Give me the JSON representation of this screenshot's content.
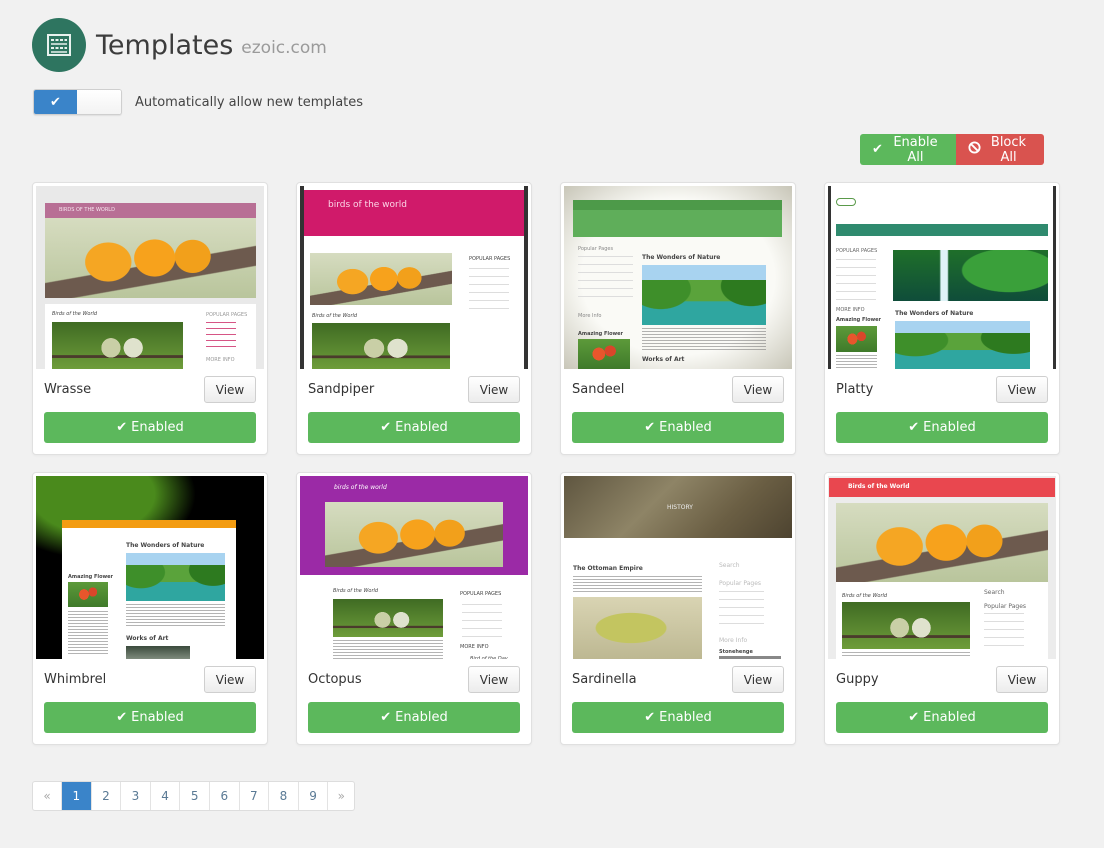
{
  "header": {
    "icon": "template-grid-icon",
    "title": "Templates",
    "site": "ezoic.com",
    "brand_color": "#2e7560"
  },
  "auto_allow": {
    "label": "Automatically allow new templates",
    "checked": true,
    "check_icon": "check-icon",
    "accent_color": "#3a84c9"
  },
  "toolbar": {
    "enable_all_label": "Enable All",
    "enable_all_icon": "check-icon",
    "block_all_label": "Block All",
    "block_all_icon": "ban-icon",
    "enable_color": "#5cb85c",
    "block_color": "#d9534f"
  },
  "templates": [
    {
      "name": "Wrasse",
      "view_label": "View",
      "status": "Enabled",
      "preview": {
        "site_title": "BIRDS OF THE WORLD",
        "heading": "Birds of the World",
        "sidebar_title": "POPULAR PAGES",
        "sidebar_more": "MORE INFO"
      }
    },
    {
      "name": "Sandpiper",
      "view_label": "View",
      "status": "Enabled",
      "preview": {
        "site_title": "birds of the world",
        "heading": "Birds of the World",
        "sidebar_title": "POPULAR PAGES"
      }
    },
    {
      "name": "Sandeel",
      "view_label": "View",
      "status": "Enabled",
      "preview": {
        "heading": "The Wonders of Nature",
        "sidebar_title": "Popular Pages",
        "sidebar_more": "More Info",
        "sub_heading": "Amazing Flower",
        "section": "Works of Art"
      }
    },
    {
      "name": "Platty",
      "view_label": "View",
      "status": "Enabled",
      "preview": {
        "heading": "The Wonders of Nature",
        "sidebar_title": "POPULAR PAGES",
        "sidebar_more": "MORE INFO",
        "sub_heading": "Amazing Flower"
      }
    },
    {
      "name": "Whimbrel",
      "view_label": "View",
      "status": "Enabled",
      "preview": {
        "heading": "The Wonders of Nature",
        "sub_heading": "Amazing Flower",
        "section": "Works of Art"
      }
    },
    {
      "name": "Octopus",
      "view_label": "View",
      "status": "Enabled",
      "preview": {
        "site_title": "birds of the world",
        "heading": "Birds of the World",
        "sidebar_title": "POPULAR PAGES",
        "sidebar_more": "MORE INFO",
        "section": "Bird of the Day"
      }
    },
    {
      "name": "Sardinella",
      "view_label": "View",
      "status": "Enabled",
      "preview": {
        "site_title": "HISTORY",
        "heading": "The Ottoman Empire",
        "sidebar_search": "Search",
        "sidebar_title": "Popular Pages",
        "sidebar_more": "More Info",
        "sub_heading": "Stonehenge"
      }
    },
    {
      "name": "Guppy",
      "view_label": "View",
      "status": "Enabled",
      "preview": {
        "site_title": "Birds of the World",
        "heading": "Birds of the World",
        "sidebar_search": "Search",
        "sidebar_title": "Popular Pages"
      }
    }
  ],
  "status_icon": "check-icon",
  "pagination": {
    "prev": "«",
    "next": "»",
    "pages": [
      "1",
      "2",
      "3",
      "4",
      "5",
      "6",
      "7",
      "8",
      "9"
    ],
    "current": "1"
  }
}
